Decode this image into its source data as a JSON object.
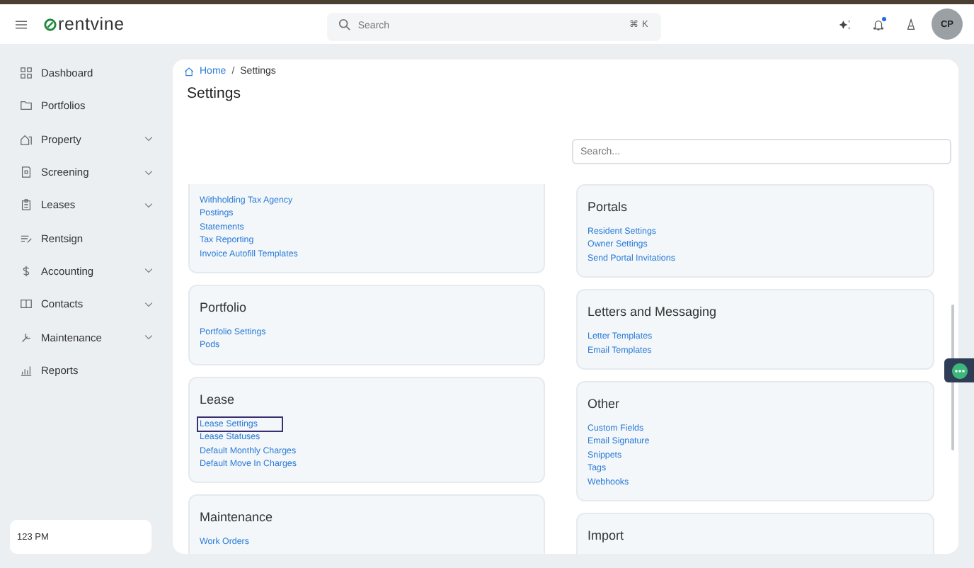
{
  "topbar": {
    "logo": "rentvine",
    "search": {
      "placeholder": "Search",
      "shortcut": "⌘ K"
    },
    "notification": true,
    "avatar": "CP"
  },
  "sidebar": {
    "items": [
      {
        "label": "Dashboard",
        "expandable": false
      },
      {
        "label": "Portfolios",
        "expandable": false
      },
      {
        "label": "Property",
        "expandable": true
      },
      {
        "label": "Screening",
        "expandable": true
      },
      {
        "label": "Leases",
        "expandable": true
      },
      {
        "label": "Rentsign",
        "expandable": false
      },
      {
        "label": "Accounting",
        "expandable": true
      },
      {
        "label": "Contacts",
        "expandable": true
      },
      {
        "label": "Maintenance",
        "expandable": true
      },
      {
        "label": "Reports",
        "expandable": false
      }
    ],
    "footer": "123 PM"
  },
  "breadcrumb": [
    "Home",
    "Settings"
  ],
  "breadcrumb_separator": "/",
  "title": "Settings",
  "settings_search": {
    "placeholder": "Search..."
  },
  "columns": [
    [
      {
        "links": [
          {
            "label": "Withholding Tax Agency",
            "focused": false
          },
          {
            "label": "Postings",
            "focused": false
          },
          {
            "label": "Statements",
            "focused": false
          },
          {
            "label": "Tax Reporting",
            "focused": false
          },
          {
            "label": "Invoice Autofill Templates",
            "focused": false
          }
        ]
      },
      {
        "title": "Portfolio",
        "links": [
          {
            "label": "Portfolio Settings",
            "focused": false
          },
          {
            "label": "Pods",
            "focused": false
          }
        ]
      },
      {
        "title": "Lease",
        "links": [
          {
            "label": "Lease Settings",
            "focused": true
          },
          {
            "label": "Lease Statuses",
            "focused": false
          },
          {
            "label": "Default Monthly Charges",
            "focused": false
          },
          {
            "label": "Default Move In Charges",
            "focused": false
          }
        ]
      },
      {
        "title": "Maintenance",
        "links": [
          {
            "label": "Work Orders",
            "focused": false
          }
        ]
      }
    ],
    [
      {
        "title": "Portals",
        "links": [
          {
            "label": "Resident Settings",
            "focused": false
          },
          {
            "label": "Owner Settings",
            "focused": false
          },
          {
            "label": "Send Portal Invitations",
            "focused": false
          }
        ]
      },
      {
        "title": "Letters and Messaging",
        "links": [
          {
            "label": "Letter Templates",
            "focused": false
          },
          {
            "label": "Email Templates",
            "focused": false
          }
        ]
      },
      {
        "title": "Other",
        "links": [
          {
            "label": "Custom Fields",
            "focused": false
          },
          {
            "label": "Email Signature",
            "focused": false
          },
          {
            "label": "Snippets",
            "focused": false
          },
          {
            "label": "Tags",
            "focused": false
          },
          {
            "label": "Webhooks",
            "focused": false
          }
        ]
      },
      {
        "title": "Import"
      }
    ]
  ]
}
